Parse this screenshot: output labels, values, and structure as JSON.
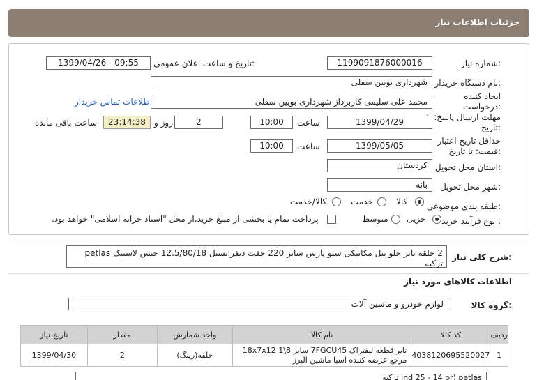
{
  "header": {
    "title": "جزئیات اطلاعات نیاز"
  },
  "form": {
    "need_number": {
      "label": "شماره نیاز:",
      "value": "1199091876000016"
    },
    "announce": {
      "label": "تاریخ و ساعت اعلان عمومی:",
      "value": "1399/04/26 - 09:55"
    },
    "buyer_org": {
      "label": "نام دستگاه خریدار:",
      "value": "شهرداری بویین سفلی"
    },
    "creator": {
      "label": "ایجاد کننده درخواست:",
      "value": "محمد علی سلیمی کاربرداز شهرداری بویین سفلی"
    },
    "contact_link": "اطلاعات تماس خریدار",
    "reply_deadline": {
      "label": "مهلت ارسال پاسخ: تا تاریخ:",
      "date": "1399/04/29",
      "time_label": "ساعت",
      "time": "10:00",
      "days": "2",
      "days_label": "روز و",
      "remaining": "23:14:38",
      "remaining_label": "ساعت باقی مانده"
    },
    "price_validity": {
      "label": "حداقل تاریخ اعتبار قیمت: تا تاریخ:",
      "date": "1399/05/05",
      "time_label": "ساعت",
      "time": "10:00"
    },
    "province": {
      "label": "استان محل تحویل:",
      "value": "کردستان"
    },
    "city": {
      "label": "شهر محل تحویل:",
      "value": "بانه"
    },
    "category": {
      "label": "طبقه بندی موضوعی:",
      "options": [
        "کالا",
        "خدمت",
        "کالا/خدمت"
      ],
      "selected": "کالا"
    },
    "process": {
      "label": "نوع فرآیند خرید :",
      "options": [
        "جزیی",
        "متوسط"
      ],
      "selected": "جزیی",
      "note": "پرداخت تمام یا بخشی از مبلغ خرید،از محل \"اسناد خزانه اسلامی\" خواهد بود."
    }
  },
  "description": {
    "label": "شرح کلی نیاز:",
    "value": "2 حلقه تایر جلو بیل مکانیکی سنو پارس سایز 220 جفت دیفرانسیل 12.5/80/18 جنس لاستیک petlas ترکیه"
  },
  "goods_section": {
    "title": "اطلاعات کالاهای مورد نیاز"
  },
  "group": {
    "label": "گروه کالا:",
    "value": "لوازم خودرو و ماشین آلات"
  },
  "table": {
    "headers": [
      "ردیف",
      "کد کالا",
      "نام کالا",
      "واحد شمارش",
      "مقدار",
      "تاریخ نیاز"
    ],
    "rows": [
      [
        "1",
        "4038120695520027",
        "تایر قطعه لیفتراک 7FGCU45 سایز 8\\1 18x7x12 مرجع عرضه کننده آسیا ماشین البرز",
        "(رینگ)حلقه",
        "2",
        "1399/04/30"
      ]
    ]
  },
  "bottom_partial": "ind 25 - 14 pr) petlas ترکیه"
}
